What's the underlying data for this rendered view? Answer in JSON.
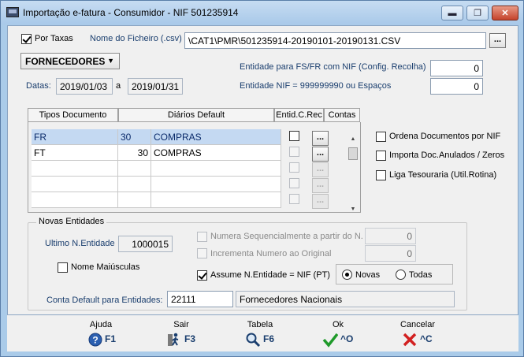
{
  "window": {
    "title": "Importação e-fatura - Consumidor - NIF 501235914",
    "controls": {
      "minimize": "▬",
      "maximize": "❐",
      "close": "✕"
    }
  },
  "top": {
    "por_taxas_label": "Por Taxas",
    "por_taxas_checked": true,
    "ficheiro_label": "Nome do Ficheiro (.csv)",
    "ficheiro_value": "\\CAT1\\PMR\\501235914-20190101-20190131.CSV",
    "browse_label": "...",
    "tipo_selected": "FORNECEDORES",
    "entidade_fs_label": "Entidade para FS/FR com NIF (Config. Recolha)",
    "entidade_fs_value": "0",
    "entidade_nif_label": "Entidade NIF = 999999990 ou Espaços",
    "entidade_nif_value": "0",
    "datas_label": "Datas:",
    "data_inicio": "2019/01/03",
    "data_sep": "a",
    "data_fim": "2019/01/31"
  },
  "grid": {
    "headers": {
      "tipos": "Tipos Documento",
      "diarios": "Diários Default",
      "entid": "Entid.C.Rec",
      "contas": "Contas"
    },
    "rows": [
      {
        "tipo": "FR",
        "num": "30",
        "diario": "COMPRAS"
      },
      {
        "tipo": "FT",
        "num": "30",
        "diario": "COMPRAS"
      },
      {
        "tipo": "",
        "num": "",
        "diario": ""
      },
      {
        "tipo": "",
        "num": "",
        "diario": ""
      },
      {
        "tipo": "",
        "num": "",
        "diario": ""
      }
    ],
    "row_button_label": "..."
  },
  "options": {
    "ordena_label": "Ordena Documentos por NIF",
    "importa_label": "Importa Doc.Anulados / Zeros",
    "liga_label": "Liga Tesouraria (Util.Rotina)"
  },
  "novas": {
    "title": "Novas Entidades",
    "ultimo_label": "Ultimo N.Entidade",
    "ultimo_value": "1000015",
    "nome_maiusculas_label": "Nome Maiúsculas",
    "numera_label": "Numera Sequencialmente a partir do N.",
    "numera_value": "0",
    "incrementa_label": "Incrementa Numero ao Original",
    "incrementa_value": "0",
    "assume_label": "Assume N.Entidade = NIF (PT)",
    "assume_checked": true,
    "radio_novas": "Novas",
    "radio_todas": "Todas",
    "conta_label": "Conta Default para Entidades:",
    "conta_value": "22111",
    "conta_desc": "Fornecedores Nacionais"
  },
  "toolbar": {
    "ajuda": {
      "label": "Ajuda",
      "key": "F1",
      "icon": "help-icon"
    },
    "sair": {
      "label": "Sair",
      "key": "F3",
      "icon": "exit-icon"
    },
    "tabela": {
      "label": "Tabela",
      "key": "F6",
      "icon": "search-icon"
    },
    "ok": {
      "label": "Ok",
      "key": "^O",
      "icon": "check-icon"
    },
    "cancelar": {
      "label": "Cancelar",
      "key": "^C",
      "icon": "cross-icon"
    }
  }
}
